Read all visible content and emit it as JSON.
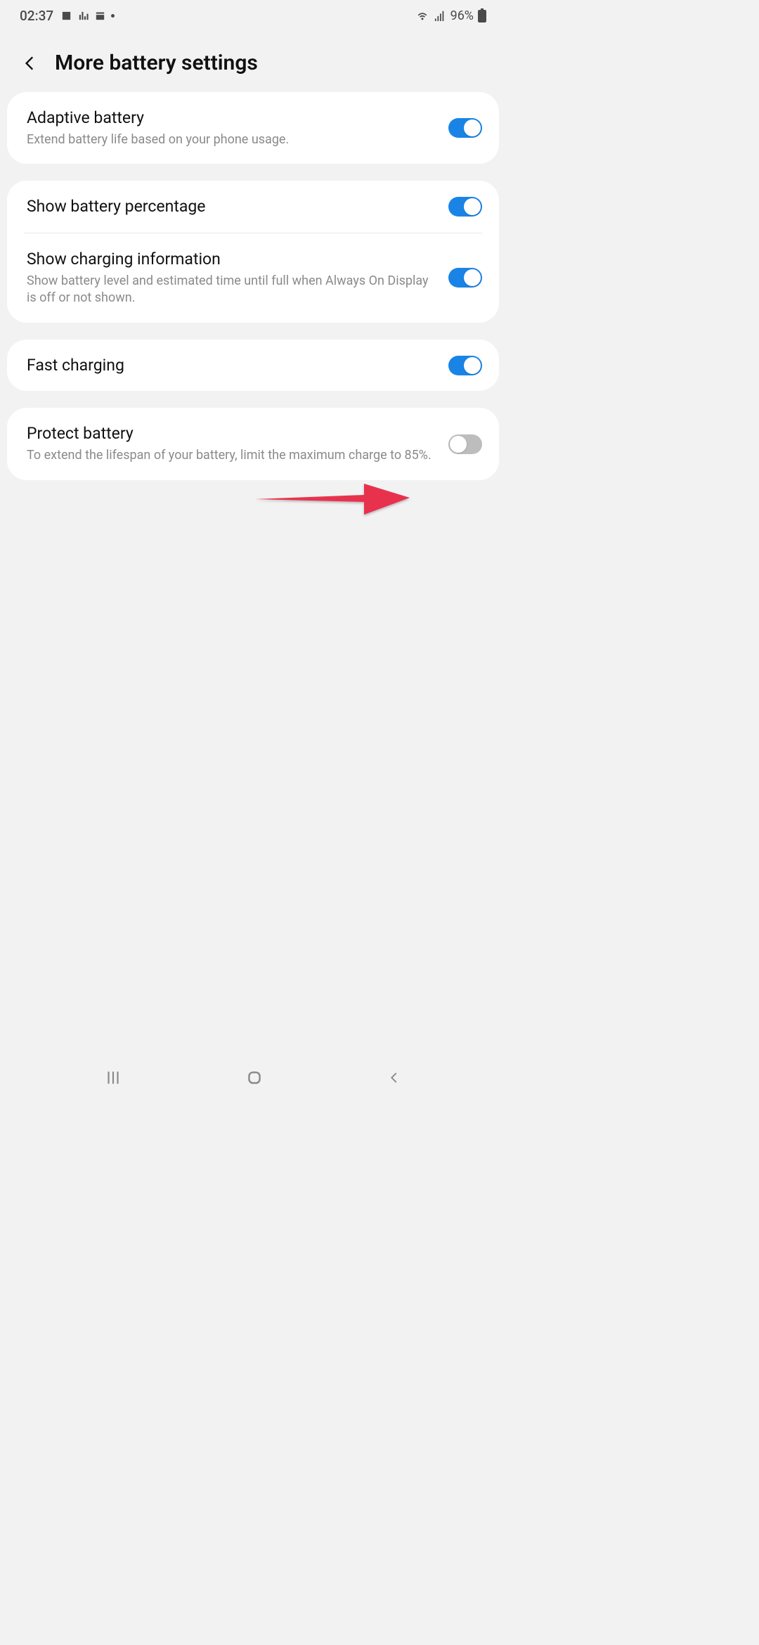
{
  "statusbar": {
    "time": "02:37",
    "battery_pct": "96%"
  },
  "header": {
    "title": "More battery settings"
  },
  "groups": [
    {
      "items": [
        {
          "title": "Adaptive battery",
          "subtitle": "Extend battery life based on your phone usage.",
          "toggle": true
        }
      ]
    },
    {
      "items": [
        {
          "title": "Show battery percentage",
          "subtitle": "",
          "toggle": true
        },
        {
          "title": "Show charging information",
          "subtitle": "Show battery level and estimated time until full when Always On Display is off or not shown.",
          "toggle": true
        }
      ]
    },
    {
      "items": [
        {
          "title": "Fast charging",
          "subtitle": "",
          "toggle": true
        }
      ]
    },
    {
      "items": [
        {
          "title": "Protect battery",
          "subtitle": "To extend the lifespan of your battery, limit the maximum charge to 85%.",
          "toggle": false
        }
      ]
    }
  ]
}
